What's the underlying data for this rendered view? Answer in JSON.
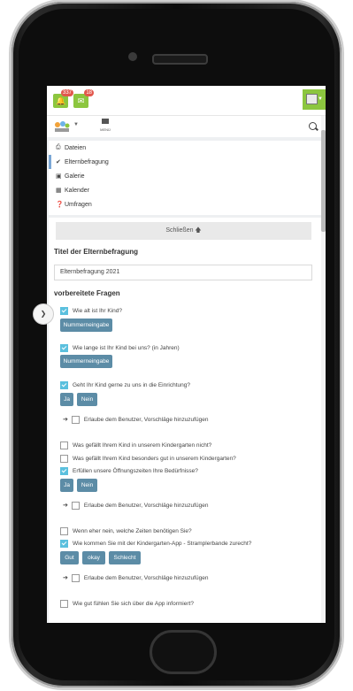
{
  "header": {
    "notif1_count": "337",
    "notif2_count": "18"
  },
  "menu": {
    "label": "MENÜ"
  },
  "nav": {
    "items": [
      {
        "icon": "⎙",
        "label": "Dateien",
        "active": false
      },
      {
        "icon": "✔",
        "label": "Elternbefragung",
        "active": true
      },
      {
        "icon": "▣",
        "label": "Galerie",
        "active": false
      },
      {
        "icon": "▦",
        "label": "Kalender",
        "active": false
      },
      {
        "icon": "❓",
        "label": "Umfragen",
        "active": false
      }
    ]
  },
  "panel": {
    "close_label": "Schließen 🡅",
    "title_heading": "Titel der Elternbefragung",
    "title_value": "Elternbefragung 2021",
    "subheading": "vorbereitete Fragen"
  },
  "questions": [
    {
      "text": "Wie alt ist Ihr Kind?",
      "checked": true
    },
    {
      "text": "Wie lange ist Ihr Kind bei uns? (in Jahren)",
      "checked": true
    },
    {
      "text": "Geht Ihr Kind gerne zu uns in die Einrichtung?",
      "checked": true
    },
    {
      "text": "Was gefällt Ihrem Kind in unserem Kindergarten nicht?",
      "checked": false
    },
    {
      "text": "Was gefällt Ihrem Kind besonders gut in unserem Kindergarten?",
      "checked": false
    },
    {
      "text": "Erfüllen unsere Öffnungszeiten Ihre Bedürfnisse?",
      "checked": true
    },
    {
      "text": "Wenn eher nein, welche Zeiten benötigen Sie?",
      "checked": false
    },
    {
      "text": "Wie kommen Sie mit der Kindergarten-App - Stramplerbande zurecht?",
      "checked": true
    },
    {
      "text": "Wie gut fühlen Sie sich über die App informiert?",
      "checked": false
    }
  ],
  "buttons": {
    "nummerneingabe": "Nummerneingabe",
    "ja": "Ja",
    "nein": "Nein",
    "gut": "Gut",
    "okay": "okay",
    "schlecht": "Schlecht"
  },
  "suggest_label": "Erlaube dem Benutzer, Vorschläge hinzuzufügen",
  "colors": {
    "accent_green": "#8cc63f",
    "checkbox_blue": "#5bc0de",
    "button_blue": "#5c8ca6",
    "badge_red": "#e2574c"
  }
}
